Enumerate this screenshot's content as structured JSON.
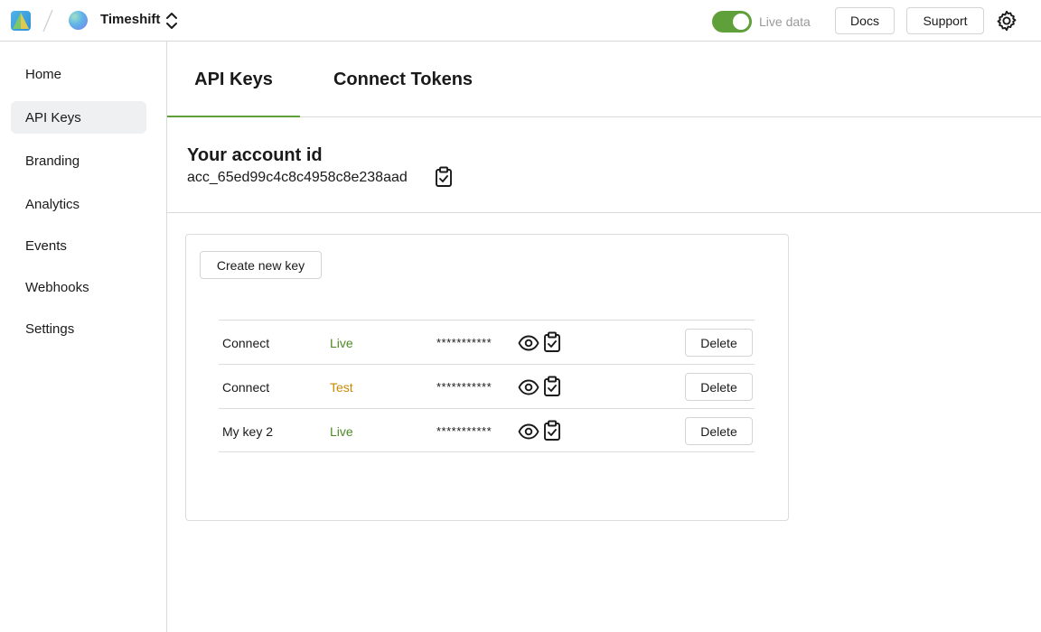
{
  "header": {
    "logo_icon": "app-logo-icon",
    "project_name": "Timeshift",
    "live_toggle": {
      "label": "Live data",
      "on": true
    },
    "docs_label": "Docs",
    "support_label": "Support",
    "settings_icon": "gear-icon",
    "colors": {
      "accent": "#5fa03a"
    }
  },
  "sidebar": {
    "items": [
      {
        "label": "Home",
        "active": false
      },
      {
        "label": "API Keys",
        "active": true
      },
      {
        "label": "Branding",
        "active": false
      },
      {
        "label": "Analytics",
        "active": false
      },
      {
        "label": "Events",
        "active": false
      },
      {
        "label": "Webhooks",
        "active": false
      },
      {
        "label": "Settings",
        "active": false
      }
    ]
  },
  "tabs": [
    {
      "label": "API Keys",
      "active": true
    },
    {
      "label": "Connect Tokens",
      "active": false
    }
  ],
  "account": {
    "title": "Your account id",
    "id": "acc_65ed99c4c8c4958c8e238aad"
  },
  "keys": {
    "create_label": "Create new key",
    "delete_label": "Delete",
    "rows": [
      {
        "name": "Connect",
        "env": "Live",
        "secret": "***********"
      },
      {
        "name": "Connect",
        "env": "Test",
        "secret": "***********"
      },
      {
        "name": "My key 2",
        "env": "Live",
        "secret": "***********"
      }
    ],
    "colors": {
      "live": "#4d8a25",
      "test": "#c88a00"
    }
  }
}
